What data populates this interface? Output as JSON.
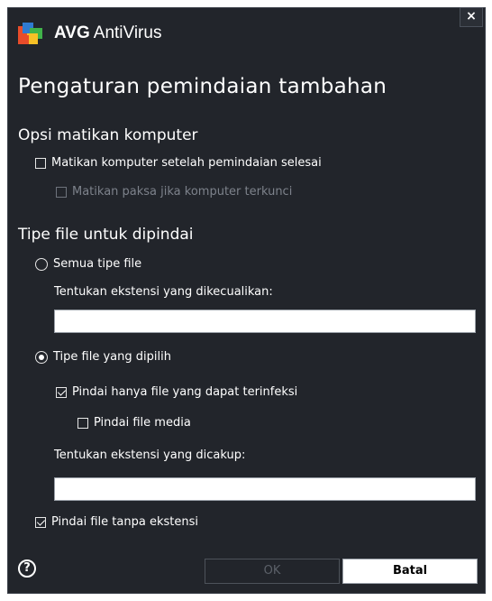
{
  "window": {
    "app_name_bold": "AVG",
    "app_name_rest": "AntiVirus",
    "close_glyph": "×",
    "page_title": "Pengaturan pemindaian tambahan"
  },
  "shutdown": {
    "section_title": "Opsi matikan komputer",
    "shutdown_after_scan": {
      "label": "Matikan komputer setelah pemindaian selesai",
      "checked": false
    },
    "force_shutdown_locked": {
      "label": "Matikan paksa jika komputer terkunci",
      "checked": false,
      "enabled": false
    }
  },
  "file_types": {
    "section_title": "Tipe file untuk dipindai",
    "all_types": {
      "label": "Semua tipe file",
      "selected": false
    },
    "exclusions": {
      "label": "Tentukan ekstensi yang dikecualikan:",
      "value": ""
    },
    "selected_types": {
      "label": "Tipe file yang dipilih",
      "selected": true
    },
    "infectable_only": {
      "label": "Pindai hanya file yang dapat terinfeksi",
      "checked": true
    },
    "media_files": {
      "label": "Pindai file media",
      "checked": false
    },
    "inclusions": {
      "label": "Tentukan ekstensi yang dicakup:",
      "value": ""
    },
    "no_extension": {
      "label": "Pindai file tanpa ekstensi",
      "checked": true
    }
  },
  "footer": {
    "help_glyph": "?",
    "ok_label": "OK",
    "cancel_label": "Batal"
  },
  "colors": {
    "background": "#22252b",
    "text": "#ffffff",
    "disabled_text": "#7d828b"
  }
}
